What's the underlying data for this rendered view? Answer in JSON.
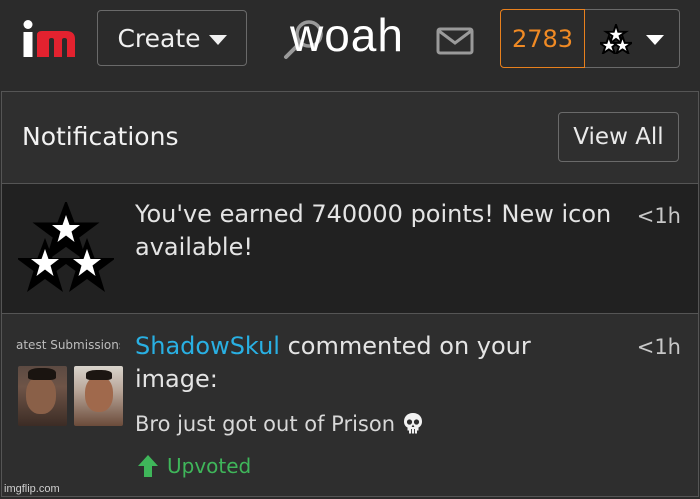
{
  "header": {
    "create_label": "Create",
    "overlay_text": "woah",
    "points": "2783"
  },
  "panel": {
    "title": "Notifications",
    "view_all_label": "View All",
    "notifications": [
      {
        "text": "You've earned 740000 points! New icon available!",
        "time": "<1h"
      },
      {
        "username": "ShadowSkul",
        "action": " commented on your image:",
        "thumbnail_caption": "atest Submissions",
        "comment": "Bro just got out of Prison",
        "vote_label": "Upvoted",
        "time": "<1h"
      }
    ]
  },
  "watermark": "imgflip.com",
  "colors": {
    "accent_orange": "#f08a24",
    "username_blue": "#29b0e3",
    "upvote_green": "#3fb65a",
    "logo_red": "#e3222f"
  },
  "icons": [
    "logo-icon",
    "search-icon",
    "mail-icon",
    "stars-avatar-icon",
    "chevron-down-icon",
    "skull-icon",
    "upvote-arrow-icon"
  ]
}
